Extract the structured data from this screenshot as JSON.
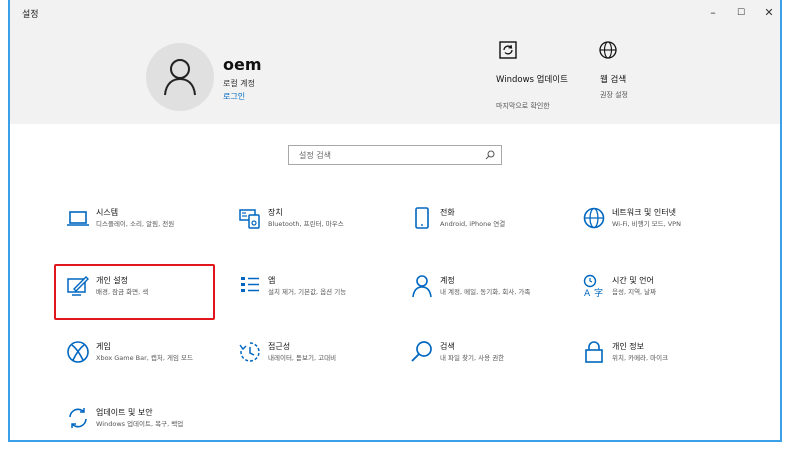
{
  "window": {
    "title": "설정",
    "minimize": "–",
    "maximize": "☐",
    "close": "✕"
  },
  "account": {
    "name": "oem",
    "type": "로컬 계정",
    "link": "로그인"
  },
  "header_items": [
    {
      "title": "Windows 업데이트",
      "sub": "마지막으로 확인한",
      "icon": "windows-update-icon"
    },
    {
      "title": "웹 검색",
      "sub": "권장 설정",
      "icon": "globe-icon"
    }
  ],
  "search": {
    "placeholder": "설정 검색"
  },
  "categories": [
    {
      "title": "시스템",
      "desc": "디스플레이, 소리, 알림, 전원",
      "icon": "laptop-icon"
    },
    {
      "title": "장치",
      "desc": "Bluetooth, 프린터, 마우스",
      "icon": "keyboard-icon"
    },
    {
      "title": "전화",
      "desc": "Android, iPhone 연결",
      "icon": "phone-icon"
    },
    {
      "title": "네트워크 및 인터넷",
      "desc": "Wi-Fi, 비행기 모드, VPN",
      "icon": "globe-icon"
    },
    {
      "title": "개인 설정",
      "desc": "배경, 잠금 화면, 색",
      "icon": "personalization-icon"
    },
    {
      "title": "앱",
      "desc": "설치 제거, 기본값, 옵션 기능",
      "icon": "apps-list-icon"
    },
    {
      "title": "계정",
      "desc": "내 계정, 메일, 동기화, 회사, 가족",
      "icon": "person-icon"
    },
    {
      "title": "시간 및 언어",
      "desc": "음성, 지역, 날짜",
      "icon": "time-language-icon"
    },
    {
      "title": "게임",
      "desc": "Xbox Game Bar, 캡처, 게임 모드",
      "icon": "xbox-icon"
    },
    {
      "title": "접근성",
      "desc": "내레이터, 돋보기, 고대비",
      "icon": "accessibility-icon"
    },
    {
      "title": "검색",
      "desc": "내 파일 찾기, 사용 권한",
      "icon": "search-icon"
    },
    {
      "title": "개인 정보",
      "desc": "위치, 카메라, 마이크",
      "icon": "lock-icon"
    },
    {
      "title": "업데이트 및 보안",
      "desc": "Windows 업데이트, 복구, 백업",
      "icon": "sync-icon"
    }
  ],
  "colors": {
    "accent": "#0067c0",
    "highlight": "#e0161c",
    "header_bg": "#f2f2f2"
  }
}
